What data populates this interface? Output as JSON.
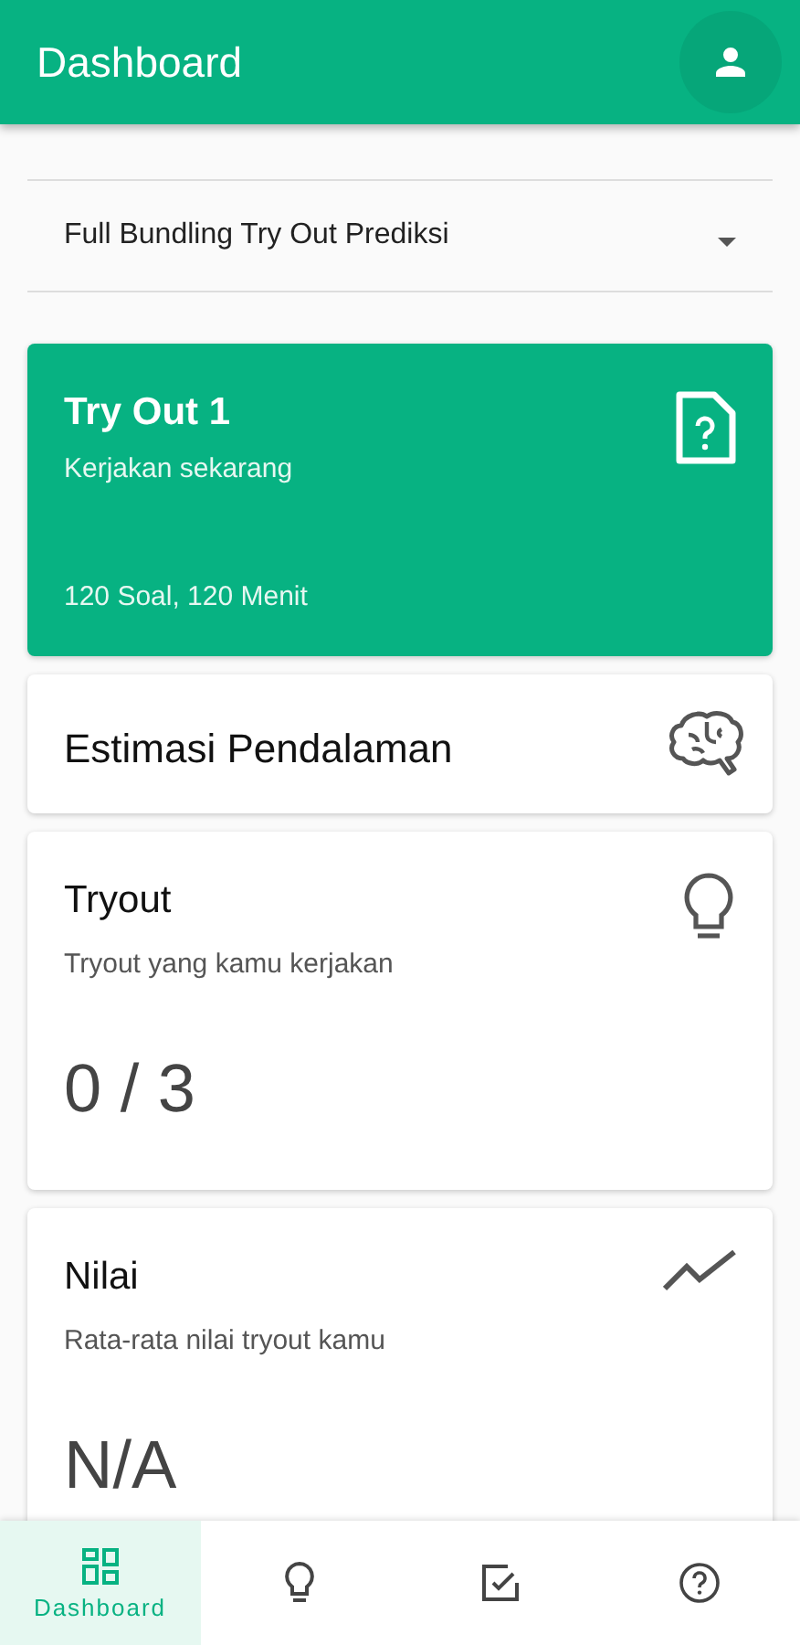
{
  "app_bar": {
    "title": "Dashboard"
  },
  "package_select": {
    "value": "Full Bundling Try Out Prediksi"
  },
  "featured_card": {
    "title": "Try Out 1",
    "subtitle": "Kerjakan sekarang",
    "details": "120 Soal, 120 Menit"
  },
  "cards": [
    {
      "kind": "brain",
      "title": "Estimasi Pendalaman"
    },
    {
      "kind": "bulb",
      "title": "Tryout",
      "subtitle": "Tryout yang kamu kerjakan",
      "value": "0 / 3"
    },
    {
      "kind": "trend",
      "title": "Nilai",
      "subtitle": "Rata-rata nilai tryout kamu",
      "value": "N/A"
    }
  ],
  "bottom_nav": [
    {
      "kind": "dashboard",
      "label": "Dashboard",
      "selected": true
    },
    {
      "kind": "bulb",
      "selected": false
    },
    {
      "kind": "checklist",
      "selected": false
    },
    {
      "kind": "help",
      "selected": false
    }
  ]
}
